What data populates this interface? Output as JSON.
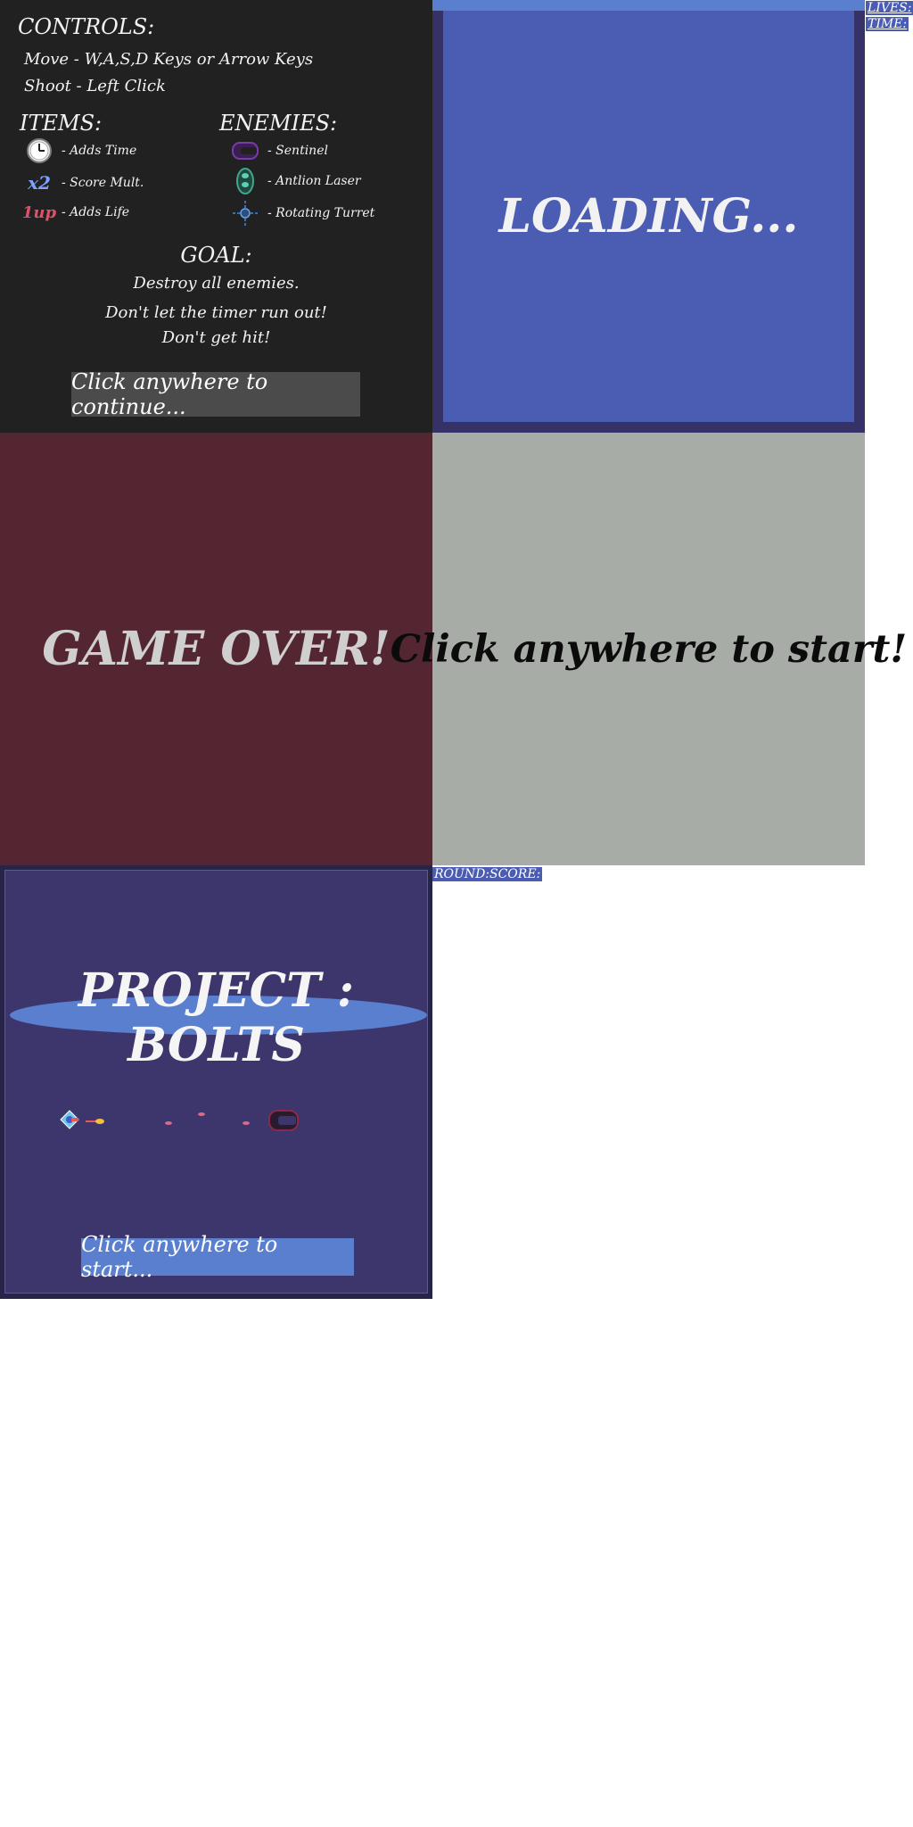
{
  "instructions": {
    "controls_heading": "CONTROLS:",
    "move_line": "Move - W,A,S,D Keys or Arrow Keys",
    "shoot_line": "Shoot - Left Click",
    "items_heading": "ITEMS:",
    "enemies_heading": "ENEMIES:",
    "items": [
      {
        "icon": "clock-icon",
        "label": "- Adds Time"
      },
      {
        "icon": "x2-icon",
        "glyph": "x2",
        "label": "- Score Mult."
      },
      {
        "icon": "1up-icon",
        "glyph": "1up",
        "label": "- Adds Life"
      }
    ],
    "enemies": [
      {
        "icon": "sentinel-icon",
        "label": "- Sentinel"
      },
      {
        "icon": "antlion-laser-icon",
        "label": "- Antlion Laser"
      },
      {
        "icon": "rotating-turret-icon",
        "label": "- Rotating Turret"
      }
    ],
    "goal_heading": "GOAL:",
    "goal_line1": "Destroy all enemies.",
    "goal_line2": "Don't let the timer run out!",
    "goal_line3": "Don't get hit!",
    "continue_label": "Click anywhere to continue..."
  },
  "loading": {
    "text": "LOADING..."
  },
  "hud": {
    "lives_label": "LIVES:",
    "time_label": "TIME:",
    "round_score": "ROUND:SCORE:"
  },
  "gameover": {
    "text": "GAME OVER!"
  },
  "start_screen": {
    "text": "Click anywhere to start!"
  },
  "title_screen": {
    "title": "PROJECT : BOLTS",
    "start_label": "Click anywhere to start..."
  },
  "colors": {
    "instructions_bg": "#212121",
    "loading_bg": "#4b5cb3",
    "gameover_bg": "#542632",
    "start_bg": "#a8aca7",
    "title_bg": "#3d366d",
    "accent": "#5a7fcf"
  }
}
